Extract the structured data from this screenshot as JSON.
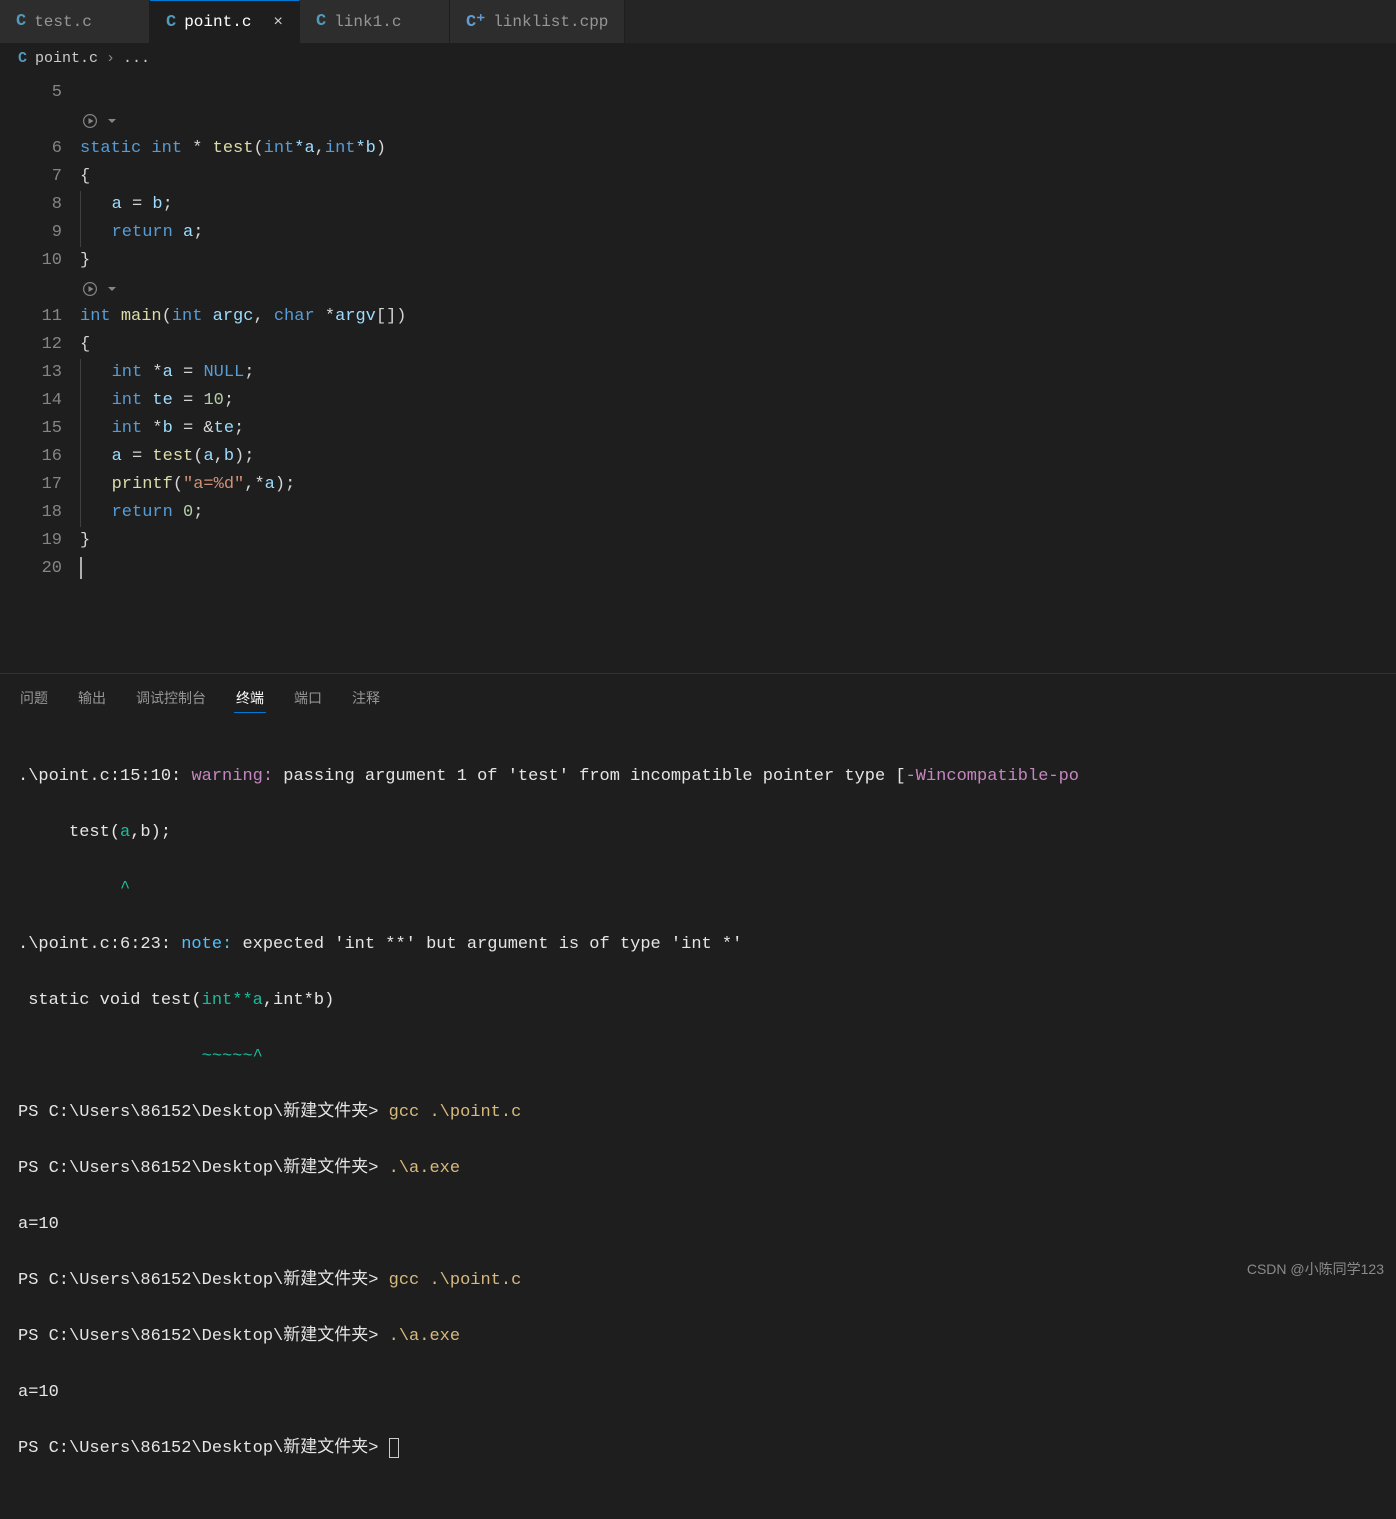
{
  "tabs": [
    {
      "icon": "C",
      "iconClass": "c-lang",
      "label": "test.c",
      "active": false
    },
    {
      "icon": "C",
      "iconClass": "c-lang",
      "label": "point.c",
      "active": true
    },
    {
      "icon": "C",
      "iconClass": "c-lang",
      "label": "link1.c",
      "active": false
    },
    {
      "icon": "C⁺",
      "iconClass": "cpp-lang",
      "label": "linklist.cpp",
      "active": false
    }
  ],
  "breadcrumb": {
    "icon": "C",
    "file": "point.c",
    "sep": "›",
    "rest": "..."
  },
  "line_numbers": [
    "5",
    "",
    "6",
    "7",
    "8",
    "9",
    "10",
    "",
    "11",
    "12",
    "13",
    "14",
    "15",
    "16",
    "17",
    "18",
    "19",
    "20"
  ],
  "code": {
    "l6": {
      "kw_static": "static",
      "type_int": "int",
      "star": " * ",
      "fn": "test",
      "open": "(",
      "t1": "int",
      "p1": "*a",
      "comma": ",",
      "t2": "int",
      "p2": "*b",
      "close": ")"
    },
    "l7": "{",
    "l8": {
      "a": "a",
      "eq": " = ",
      "b": "b",
      "semi": ";"
    },
    "l9": {
      "ret": "return",
      "sp": " ",
      "a": "a",
      "semi": ";"
    },
    "l10": "}",
    "l11": {
      "type": "int",
      "fn": "main",
      "open": "(",
      "t1": "int",
      "p1": "argc",
      "comma": ", ",
      "t2": "char",
      "star": " *",
      "p2": "argv",
      "br": "[]",
      "close": ")"
    },
    "l12": "{",
    "l13": {
      "type": "int",
      "star": " *",
      "a": "a",
      "eq": " = ",
      "null": "NULL",
      "semi": ";"
    },
    "l14": {
      "type": "int",
      "sp": " ",
      "te": "te",
      "eq": " = ",
      "num": "10",
      "semi": ";"
    },
    "l15": {
      "type": "int",
      "star": " *",
      "b": "b",
      "eq": " = &",
      "te": "te",
      "semi": ";"
    },
    "l16": {
      "a": "a",
      "eq": " = ",
      "fn": "test",
      "open": "(",
      "p1": "a",
      "comma": ",",
      "p2": "b",
      "close": ")",
      "semi": ";"
    },
    "l17": {
      "fn": "printf",
      "open": "(",
      "str": "\"a=%d\"",
      "comma": ",*",
      "a": "a",
      "close": ")",
      "semi": ";"
    },
    "l18": {
      "ret": "return",
      "sp": " ",
      "num": "0",
      "semi": ";"
    },
    "l19": "}"
  },
  "panel_tabs": [
    {
      "label": "问题",
      "active": false
    },
    {
      "label": "输出",
      "active": false
    },
    {
      "label": "调试控制台",
      "active": false
    },
    {
      "label": "终端",
      "active": true
    },
    {
      "label": "端口",
      "active": false
    },
    {
      "label": "注释",
      "active": false
    }
  ],
  "terminal": {
    "warn_loc": ".\\point.c:15:10:",
    "warn_label": "warning:",
    "warn_msg": " passing argument 1 of 'test' from incompatible pointer type [",
    "warn_flag": "-Wincompatible-po",
    "warn_code_indent": "     test(",
    "warn_code_a": "a",
    "warn_code_rest": ",b);",
    "warn_caret_indent": "          ",
    "warn_caret": "^",
    "note_loc": ".\\point.c:6:23:",
    "note_label": "note:",
    "note_msg": " expected 'int **' but argument is of type 'int *'",
    "note_code_prefix": " static void test(",
    "note_code_hl": "int**a",
    "note_code_rest": ",int*b)",
    "note_under_indent": "                  ",
    "note_under": "~~~~~^",
    "ps_prefix": "PS C:\\Users\\86152\\Desktop\\新建文件夹> ",
    "cmd1": "gcc .\\point.c",
    "cmd2": ".\\a.exe",
    "out1": "a=10",
    "cmd3": "gcc .\\point.c",
    "cmd4": ".\\a.exe",
    "out2": "a=10"
  },
  "watermark": "CSDN @小陈同学123"
}
